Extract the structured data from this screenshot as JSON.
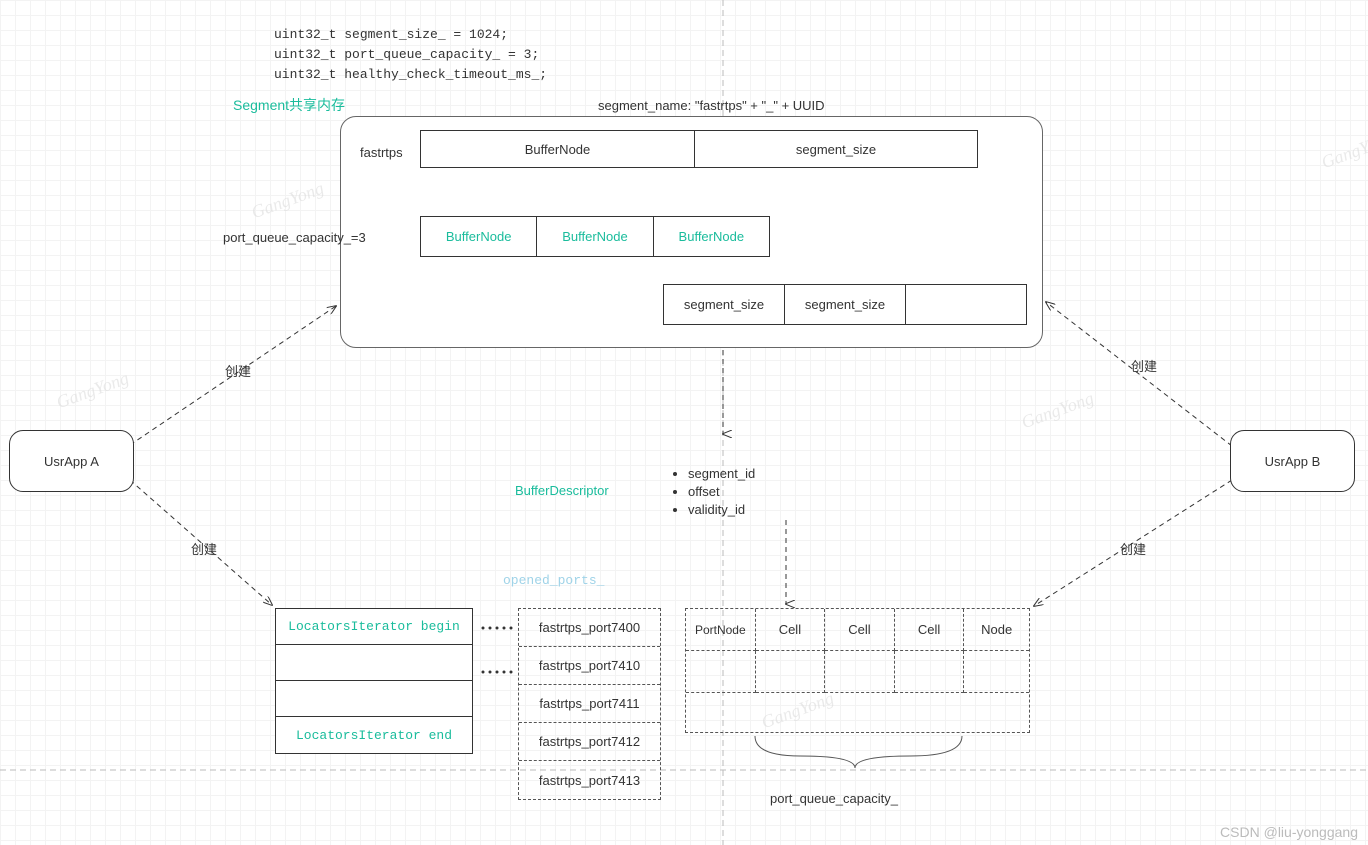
{
  "code": {
    "l1": "uint32_t segment_size_ = 1024;",
    "l2": "uint32_t port_queue_capacity_ = 3;",
    "l3": "uint32_t healthy_check_timeout_ms_;"
  },
  "segment_title": "Segment共享内存",
  "segment_name": "segment_name: \"fastrtps\" + \"_\" + UUID",
  "fastrtps_label": "fastrtps",
  "row1": {
    "a": "BufferNode",
    "b": "segment_size"
  },
  "pqc_label": "port_queue_capacity_=3",
  "row2": {
    "a": "BufferNode",
    "b": "BufferNode",
    "c": "BufferNode"
  },
  "row3": {
    "a": "segment_size",
    "b": "segment_size"
  },
  "usr_a": "UsrApp A",
  "usr_b": "UsrApp B",
  "create_label": "创建",
  "buffer_descriptor": "BufferDescriptor",
  "bd_items": {
    "a": "segment_id",
    "b": "offset",
    "c": "validity_id"
  },
  "opened_ports": "opened_ports_",
  "locators": {
    "begin": "LocatorsIterator begin",
    "end": "LocatorsIterator end"
  },
  "ports": {
    "p0": "fastrtps_port7400",
    "p1": "fastrtps_port7410",
    "p2": "fastrtps_port7411",
    "p3": "fastrtps_port7412",
    "p4": "fastrtps_port7413"
  },
  "node_hdr": {
    "a": "PortNode",
    "b": "Cell",
    "c": "Cell",
    "d": "Cell",
    "e": "Node"
  },
  "pqc2": "port_queue_capacity_",
  "watermark": "GangYong",
  "credit": "CSDN @liu-yonggang"
}
